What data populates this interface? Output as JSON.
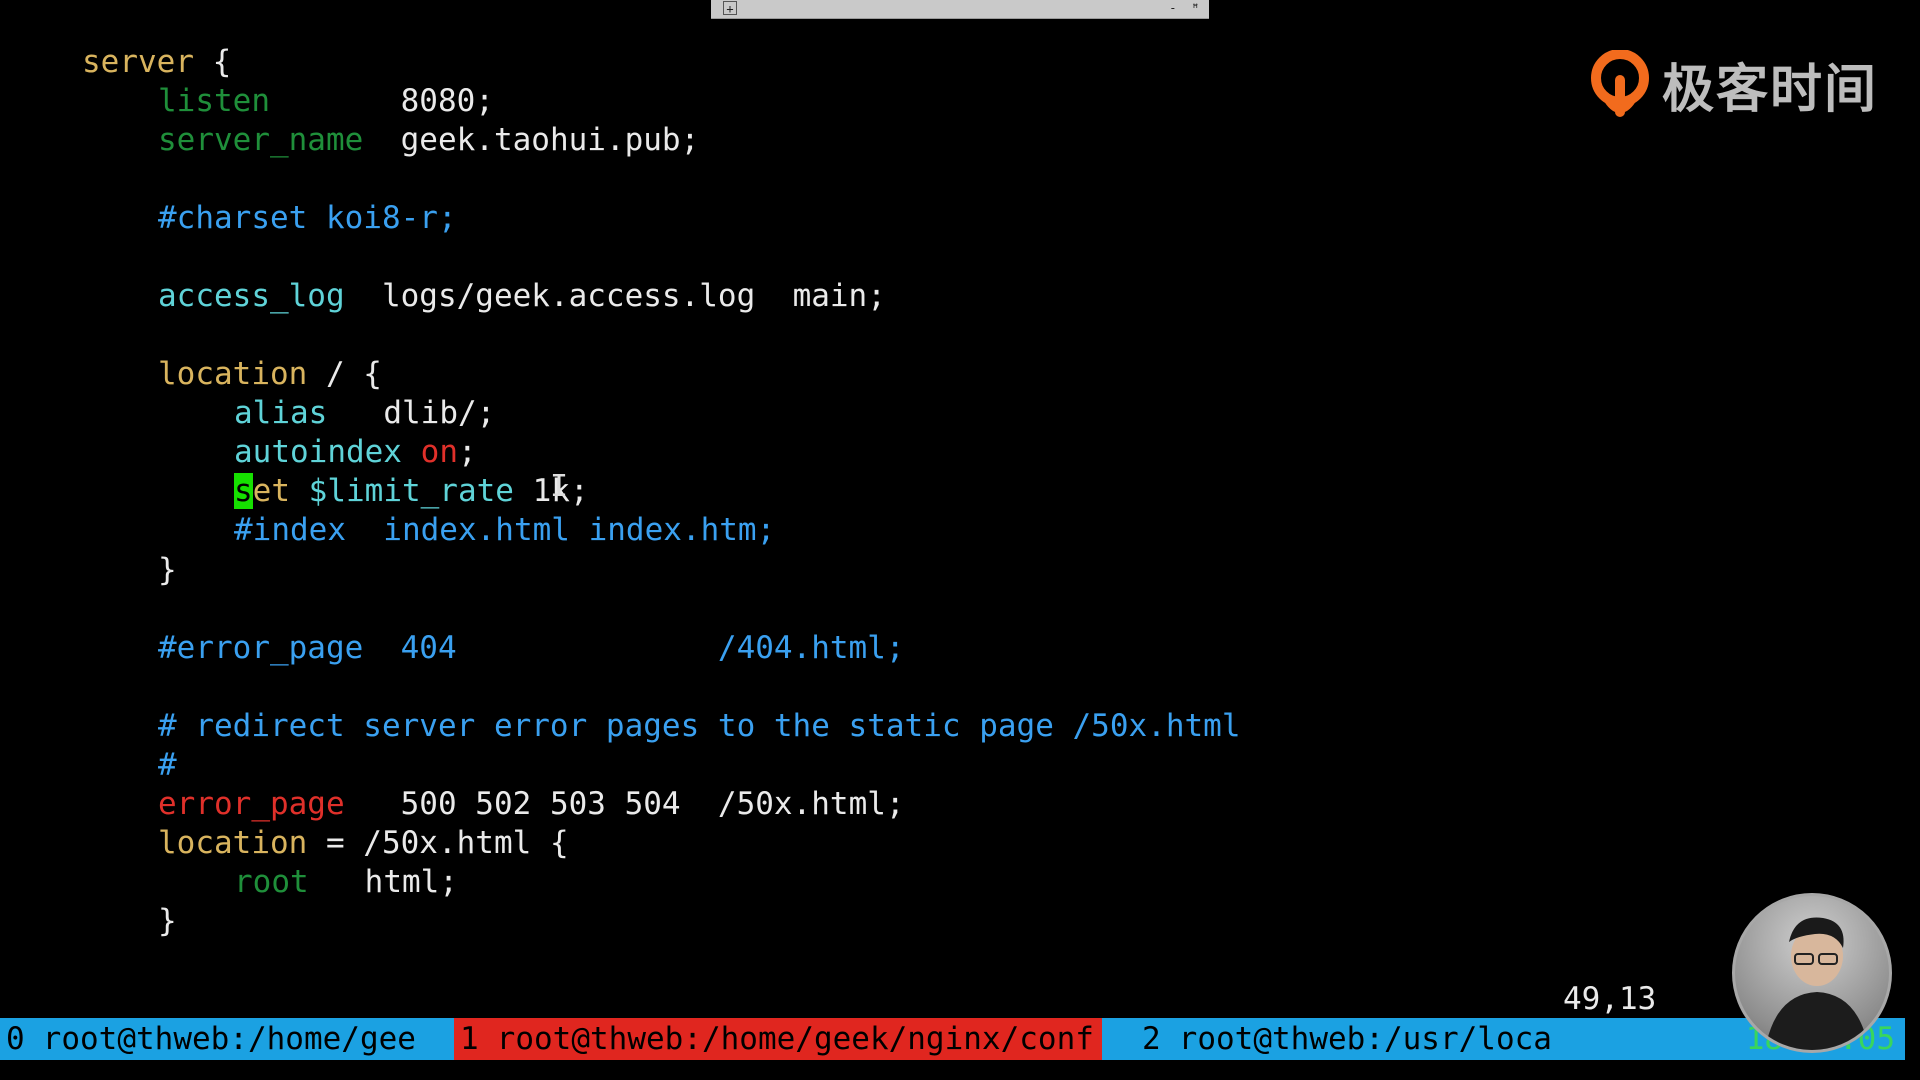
{
  "topbar": {
    "pin_label": "+",
    "min_label": "-",
    "restore_label": "ꟸ"
  },
  "logo": {
    "text": "极客时间",
    "accent": "#f26b1d"
  },
  "code": {
    "l1": {
      "kw": "server",
      "rest": " {"
    },
    "l2": {
      "dir": "listen",
      "val": "8080;"
    },
    "l3": {
      "dir": "server_name",
      "val": "geek.taohui.pub;"
    },
    "l4": {
      "cmt": "#charset koi8-r;"
    },
    "l5": {
      "dir": "access_log",
      "val": "logs/geek.access.log  main;"
    },
    "l6": {
      "kw": "location",
      "rest": " / {"
    },
    "l7": {
      "dir": "alias",
      "val": "dlib/;"
    },
    "l8": {
      "dir": "autoindex",
      "on": "on",
      "semi": ";"
    },
    "l9": {
      "cursor_char": "s",
      "kw": "et",
      "var": " $limit_rate",
      "val": " 1k;"
    },
    "l10": {
      "cmt": "#index  index.html index.htm;"
    },
    "l11": {
      "brace": "}"
    },
    "l12": {
      "cmt": "#error_page  404              /404.html;"
    },
    "l13": {
      "cmt": "# redirect server error pages to the static page /50x.html"
    },
    "l14": {
      "cmt": "#"
    },
    "l15": {
      "dir": "error_page",
      "val": "500 502 503 504  /50x.html;"
    },
    "l16": {
      "kw": "location",
      "rest": " = /50x.html {"
    },
    "l17": {
      "dir": "root",
      "val": "html;"
    },
    "l18": {
      "brace": "}"
    }
  },
  "ruler": "49,13",
  "status": {
    "tab0_index": "0",
    "tab0_label": "root@thweb:/home/gee",
    "tab1_index": "1",
    "tab1_label": "root@thweb:/home/geek/nginx/conf",
    "tab2_index": "2",
    "tab2_label": "root@thweb:/usr/loca",
    "time": "18:5 :05"
  },
  "colors": {
    "keyword": "#d9b45e",
    "directive": "#5fd3d8",
    "comment": "#3aa0f0",
    "error": "#e0302a",
    "status_bg": "#1ba1e2",
    "active_tab": "#e0261f",
    "cursor": "#16e000"
  }
}
